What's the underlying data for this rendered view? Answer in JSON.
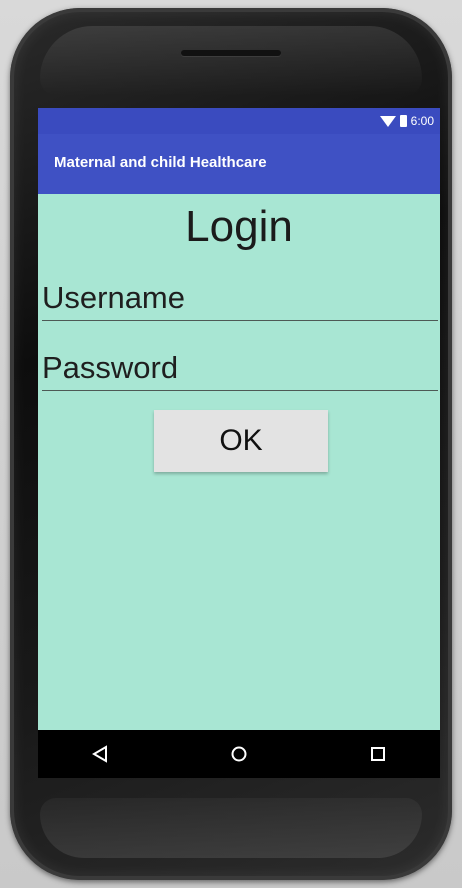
{
  "status_bar": {
    "time": "6:00",
    "icons": [
      "wifi-icon",
      "battery-icon"
    ]
  },
  "app_bar": {
    "title": "Maternal and child Healthcare",
    "color": "#3f51c4"
  },
  "login": {
    "heading": "Login",
    "username_placeholder": "Username",
    "password_placeholder": "Password",
    "ok_label": "OK",
    "background_color": "#a8e6d3"
  },
  "nav_bar": {
    "icons": [
      "back-icon",
      "home-icon",
      "recents-icon"
    ]
  }
}
